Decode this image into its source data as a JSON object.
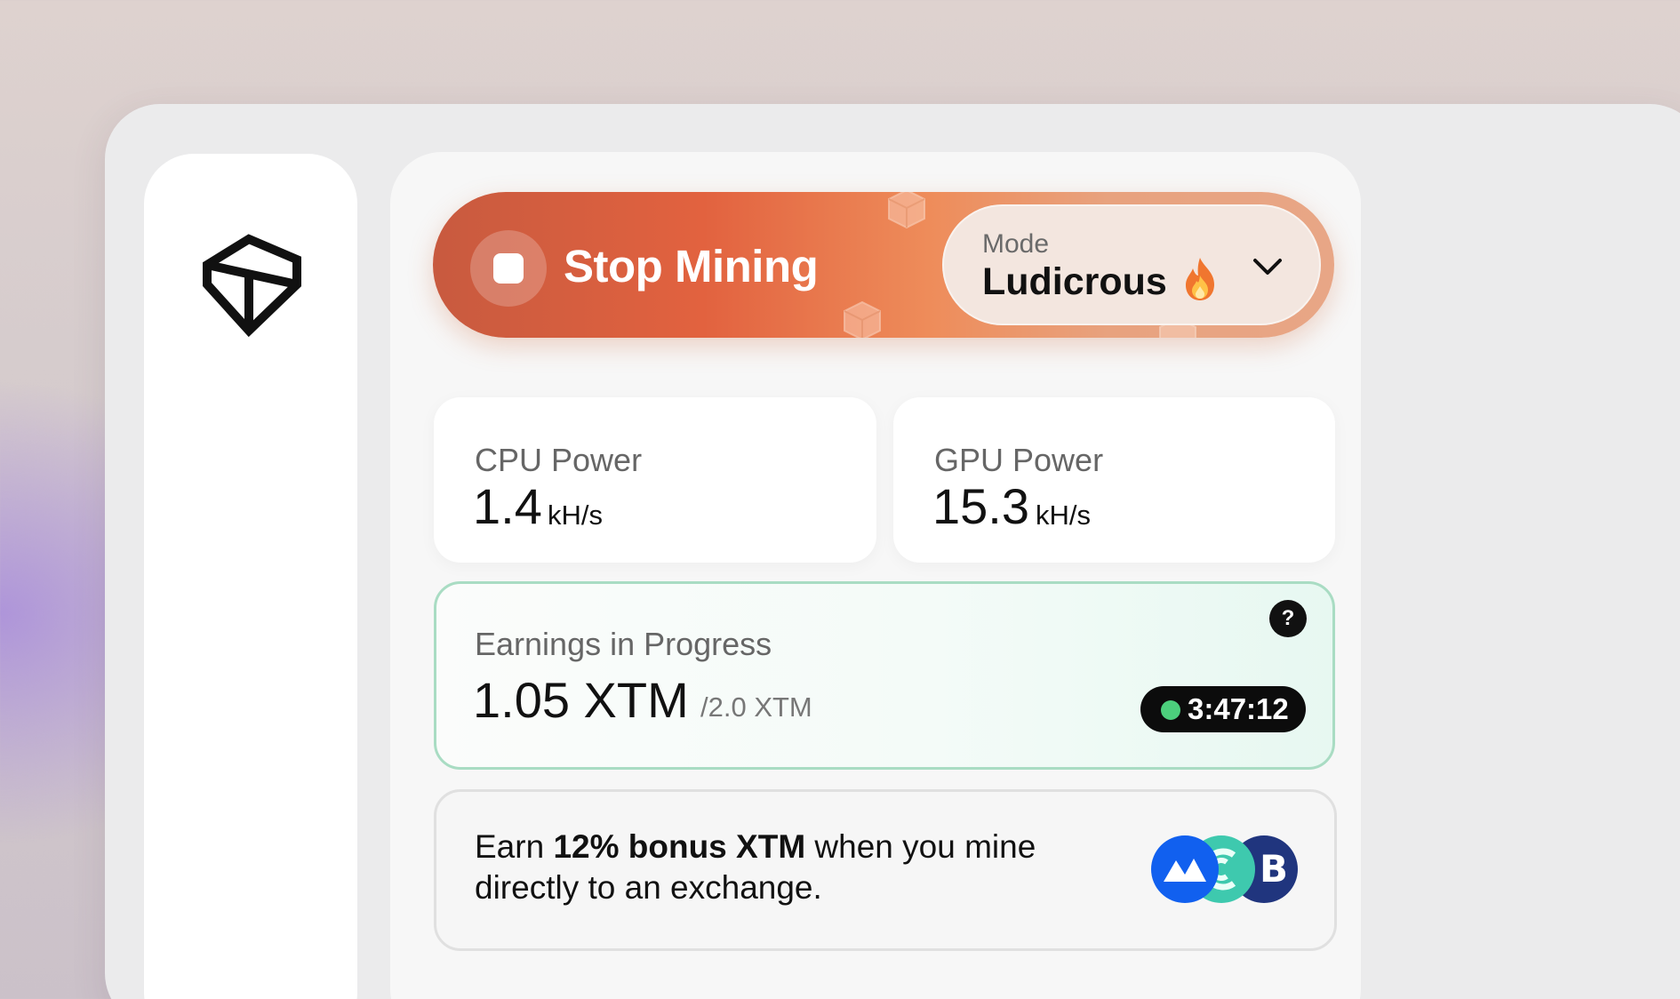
{
  "mining": {
    "action_label": "Stop Mining",
    "mode_caption": "Mode",
    "mode_value": "Ludicrous"
  },
  "stats": {
    "cpu": {
      "label": "CPU Power",
      "value": "1.4",
      "unit": "kH/s"
    },
    "gpu": {
      "label": "GPU Power",
      "value": "15.3",
      "unit": "kH/s"
    }
  },
  "earnings": {
    "label": "Earnings in Progress",
    "value": "1.05 XTM",
    "target": "/2.0 XTM",
    "help": "?",
    "timer": "3:47:12"
  },
  "bonus": {
    "prefix": "Earn ",
    "highlight": "12% bonus XTM",
    "suffix": " when you mine directly to an exchange."
  },
  "icons": [
    "tari-logo-icon",
    "stop-icon",
    "fire-icon",
    "chevron-down-icon",
    "help-icon",
    "exchange-logo-icons"
  ],
  "colors": {
    "accent": "#e2623f",
    "earnings_border": "#a9dcc3",
    "timer_dot": "#4ccf7c"
  }
}
